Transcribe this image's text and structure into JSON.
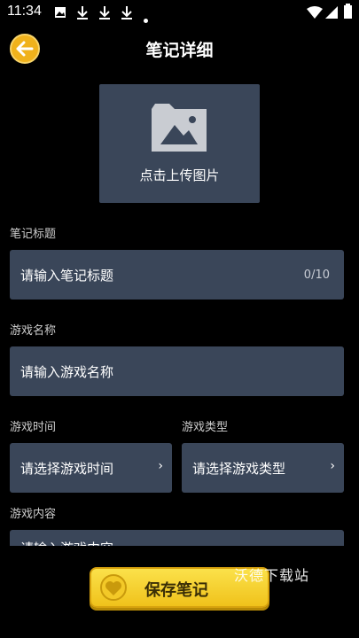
{
  "status_bar": {
    "time": "11:34"
  },
  "header": {
    "title": "笔记详细"
  },
  "upload": {
    "label": "点击上传图片"
  },
  "note_title": {
    "label": "笔记标题",
    "placeholder": "请输入笔记标题",
    "counter": "0/10"
  },
  "game_name": {
    "label": "游戏名称",
    "placeholder": "请输入游戏名称"
  },
  "game_time": {
    "label": "游戏时间",
    "placeholder": "请选择游戏时间"
  },
  "game_type": {
    "label": "游戏类型",
    "placeholder": "请选择游戏类型"
  },
  "game_content": {
    "label": "游戏内容",
    "placeholder": "请输入游戏内容"
  },
  "save_button": {
    "label": "保存笔记"
  },
  "watermark": {
    "text": "沃德下载站"
  },
  "colors": {
    "accent": "#f0b21c",
    "field_bg": "#3a4659",
    "background": "#000000"
  }
}
